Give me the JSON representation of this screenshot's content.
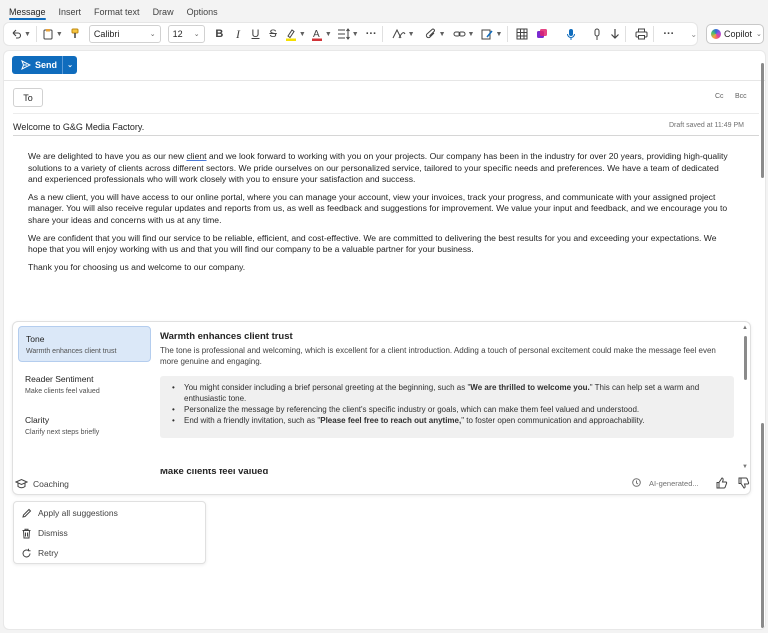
{
  "tabs": [
    "Message",
    "Insert",
    "Format text",
    "Draw",
    "Options"
  ],
  "toolbar": {
    "font": "Calibri",
    "size": "12",
    "copilot_label": "Copilot",
    "accent": "#0f6cbd"
  },
  "compose": {
    "send_label": "Send",
    "to_label": "To",
    "cc_label": "Cc",
    "bcc_label": "Bcc",
    "subject": "Welcome to G&G Media Factory.",
    "draft_status": "Draft saved at 11:49 PM",
    "body": {
      "p1_before": "We are delighted to have you as our new ",
      "p1_flagged": "client",
      "p1_after": " and we look forward to working with you on your projects. Our company has been in the industry for over 20 years, providing high-quality solutions to a variety of clients across different sectors. We pride ourselves on our personalized service, tailored to your specific needs and preferences. We have a team of dedicated and experienced professionals who will work closely with you to ensure your satisfaction and success.",
      "p2": "As a new client, you will have access to our online portal, where you can manage your account, view your invoices, track your progress, and communicate with your assigned project manager. You will also receive regular updates and reports from us, as well as feedback and suggestions for improvement. We value your input and feedback, and we encourage you to share your ideas and concerns with us at any time.",
      "p3": "We are confident that you will find our service to be reliable, efficient, and cost-effective. We are committed to delivering the best results for you and exceeding your expectations. We hope that you will enjoy working with us and that you will find our company to be a valuable partner for your business.",
      "p4": "Thank you for choosing us and welcome to our company."
    }
  },
  "coaching": {
    "label": "Coaching",
    "ai_label": "AI-generated...",
    "categories": [
      {
        "title": "Tone",
        "subtitle": "Warmth enhances client trust"
      },
      {
        "title": "Reader Sentiment",
        "subtitle": "Make clients feel valued"
      },
      {
        "title": "Clarity",
        "subtitle": "Clarify next steps briefly"
      }
    ],
    "detail": {
      "title": "Warmth enhances client trust",
      "description": "The tone is professional and welcoming, which is excellent for a client introduction. Adding a touch of personal excitement could make the message feel even more genuine and engaging.",
      "s1_before": "You might consider including a brief personal greeting at the beginning, such as \"",
      "s1_bold": "We are thrilled to welcome you.",
      "s1_after": "\" This can help set a warm and enthusiastic tone.",
      "s2": "Personalize the message by referencing the client's specific industry or goals, which can make them feel valued and understood.",
      "s3_before": "End with a friendly invitation, such as \"",
      "s3_bold": "Please feel free to reach out anytime,",
      "s3_after": "\" to foster open communication and approachability.",
      "next_heading": "Make clients feel valued"
    }
  },
  "actions": [
    "Apply all suggestions",
    "Dismiss",
    "Retry"
  ]
}
